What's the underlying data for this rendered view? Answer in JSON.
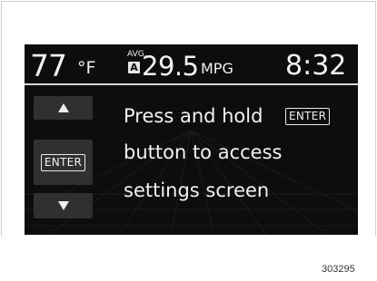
{
  "display": {
    "temperature": "77",
    "temperature_unit": "°F",
    "avg_label": "AVG.",
    "avg_badge": "A",
    "fuel_economy": "29.5",
    "fuel_economy_unit": "MPG",
    "clock": "8:32"
  },
  "side_buttons": {
    "up_icon": "triangle-up-icon",
    "enter_label": "ENTER",
    "down_icon": "triangle-down-icon"
  },
  "message": {
    "line1": "Press and hold",
    "line1_button": "ENTER",
    "line2": "button to access",
    "line3": "settings screen"
  },
  "figure_number": "303295"
}
